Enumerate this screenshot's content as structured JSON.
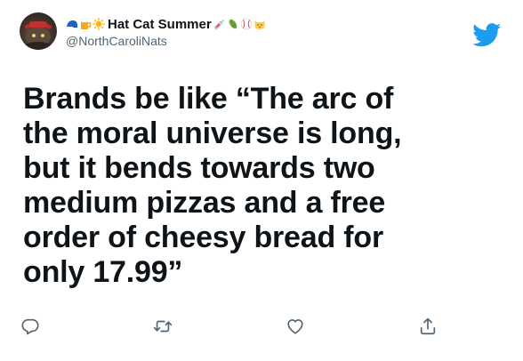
{
  "user": {
    "display_name": "Hat Cat Summer",
    "handle": "@NorthCaroliNats",
    "name_prefix_emojis": [
      "cap-emoji",
      "beer-mug-emoji",
      "sun-emoji"
    ],
    "name_suffix_emojis": [
      "syringe-emoji",
      "pickle-emoji",
      "baseball-emoji",
      "cat-face-emoji"
    ]
  },
  "tweet": {
    "text": "Brands be like “The arc of\nthe moral universe is long,\nbut it bends towards two\nmedium pizzas and a free\norder of cheesy bread for\nonly 17.99”"
  },
  "actions": [
    "reply",
    "retweet",
    "like",
    "share"
  ],
  "colors": {
    "text": "#0f1419",
    "secondary": "#536471",
    "twitter_blue": "#1d9bf0"
  }
}
